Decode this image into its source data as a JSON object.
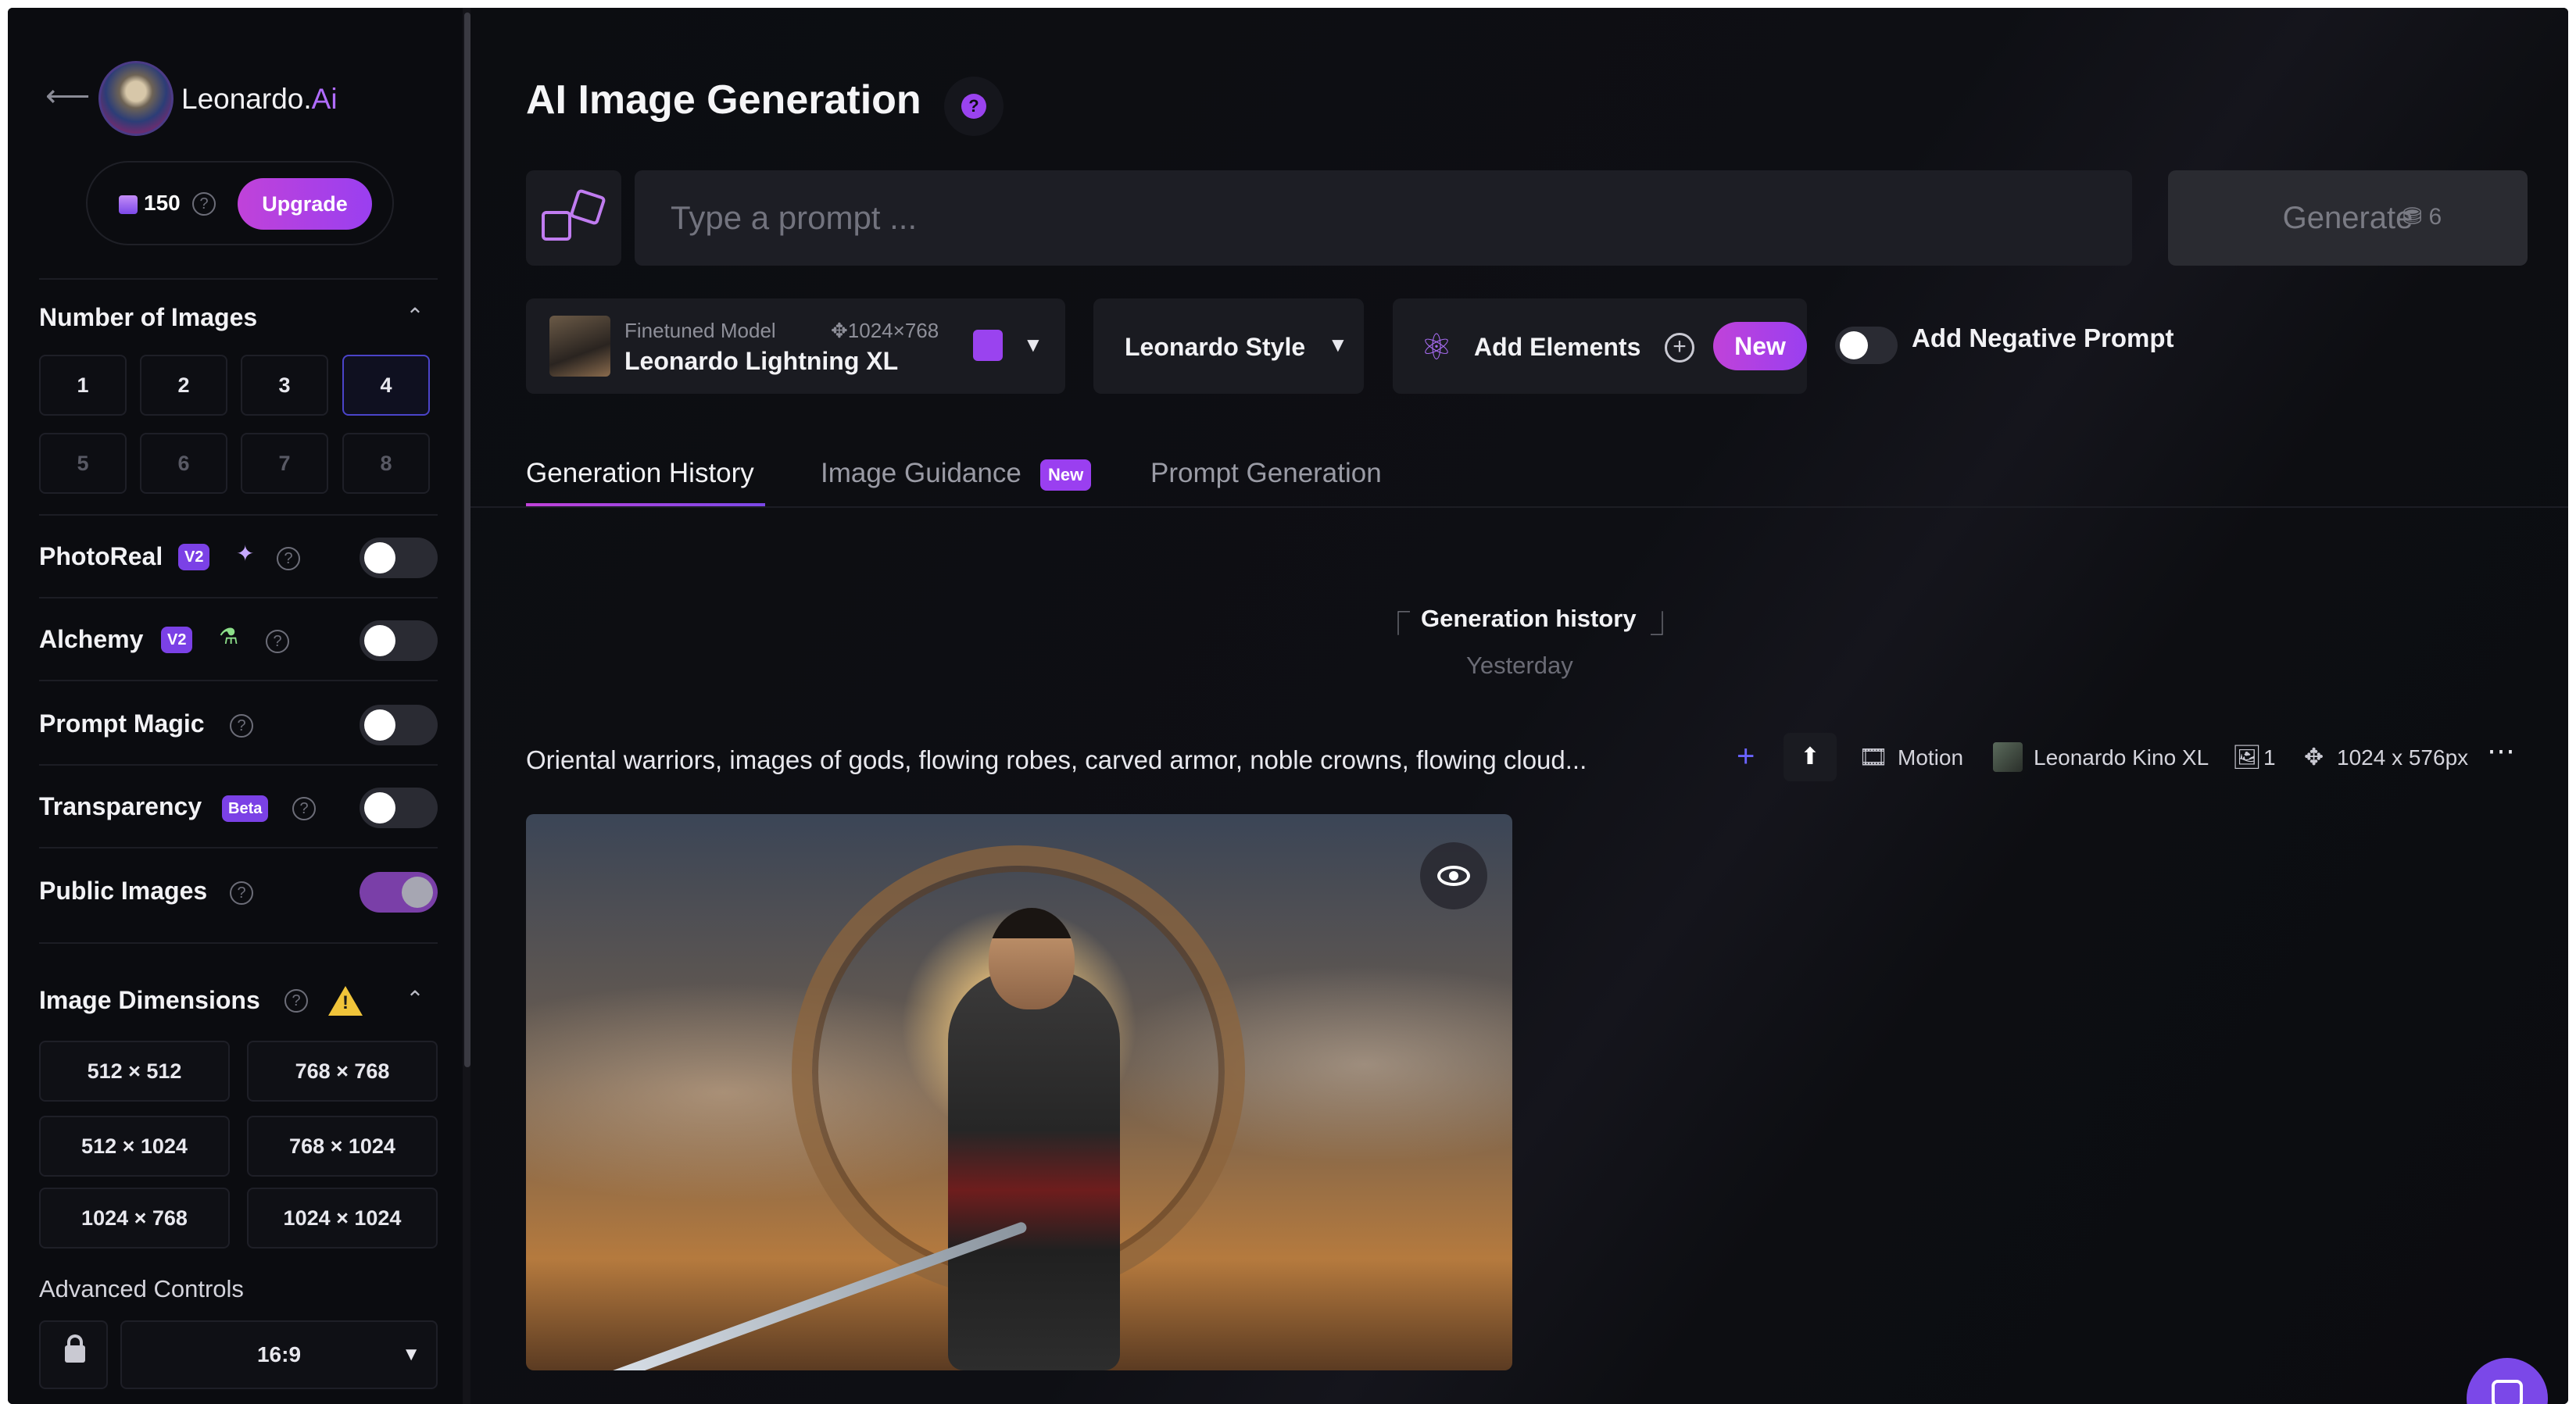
{
  "brand": {
    "name": "Leonardo.",
    "suffix": "Ai"
  },
  "nav": {
    "back_icon": "arrow-left-icon"
  },
  "credits": {
    "count": "150",
    "upgrade_label": "Upgrade"
  },
  "sidebar": {
    "number_of_images": {
      "title": "Number of Images",
      "options": [
        "1",
        "2",
        "3",
        "4",
        "5",
        "6",
        "7",
        "8"
      ],
      "selected": "4"
    },
    "toggles": [
      {
        "label": "PhotoReal",
        "badge": "V2",
        "on": false
      },
      {
        "label": "Alchemy",
        "badge": "V2",
        "on": false
      },
      {
        "label": "Prompt Magic",
        "on": false
      },
      {
        "label": "Transparency",
        "badge": "Beta",
        "on": false
      },
      {
        "label": "Public Images",
        "on": true
      }
    ],
    "image_dimensions": {
      "title": "Image Dimensions",
      "options": [
        "512 × 512",
        "768 × 768",
        "512 × 1024",
        "768 × 1024",
        "1024 × 768",
        "1024 × 1024"
      ]
    },
    "advanced_controls": {
      "label": "Advanced Controls",
      "aspect_ratio": "16:9"
    }
  },
  "main": {
    "title": "AI Image Generation",
    "prompt": {
      "placeholder": "Type a prompt ...",
      "value": ""
    },
    "generate": {
      "label": "Generate",
      "cost": "6"
    },
    "model": {
      "subtitle": "Finetuned Model",
      "dimensions": "1024×768",
      "name": "Leonardo Lightning XL"
    },
    "style": {
      "label": "Leonardo Style"
    },
    "elements": {
      "label": "Add Elements",
      "badge": "New"
    },
    "negative_prompt": {
      "label": "Add Negative Prompt",
      "on": false
    },
    "tabs": [
      {
        "label": "Generation History",
        "active": true
      },
      {
        "label": "Image Guidance",
        "badge": "New"
      },
      {
        "label": "Prompt Generation"
      }
    ],
    "history": {
      "heading": "Generation history",
      "day": "Yesterday",
      "generation": {
        "prompt": "Oriental warriors, images of gods, flowing robes, carved armor, noble crowns, flowing cloud...",
        "mode": "Motion",
        "model": "Leonardo Kino XL",
        "count": "1",
        "size": "1024 x 576px"
      }
    }
  },
  "colors": {
    "accent": "#9a3ff0",
    "brand_gradient_start": "#c042d9",
    "background": "#0d0d11"
  }
}
